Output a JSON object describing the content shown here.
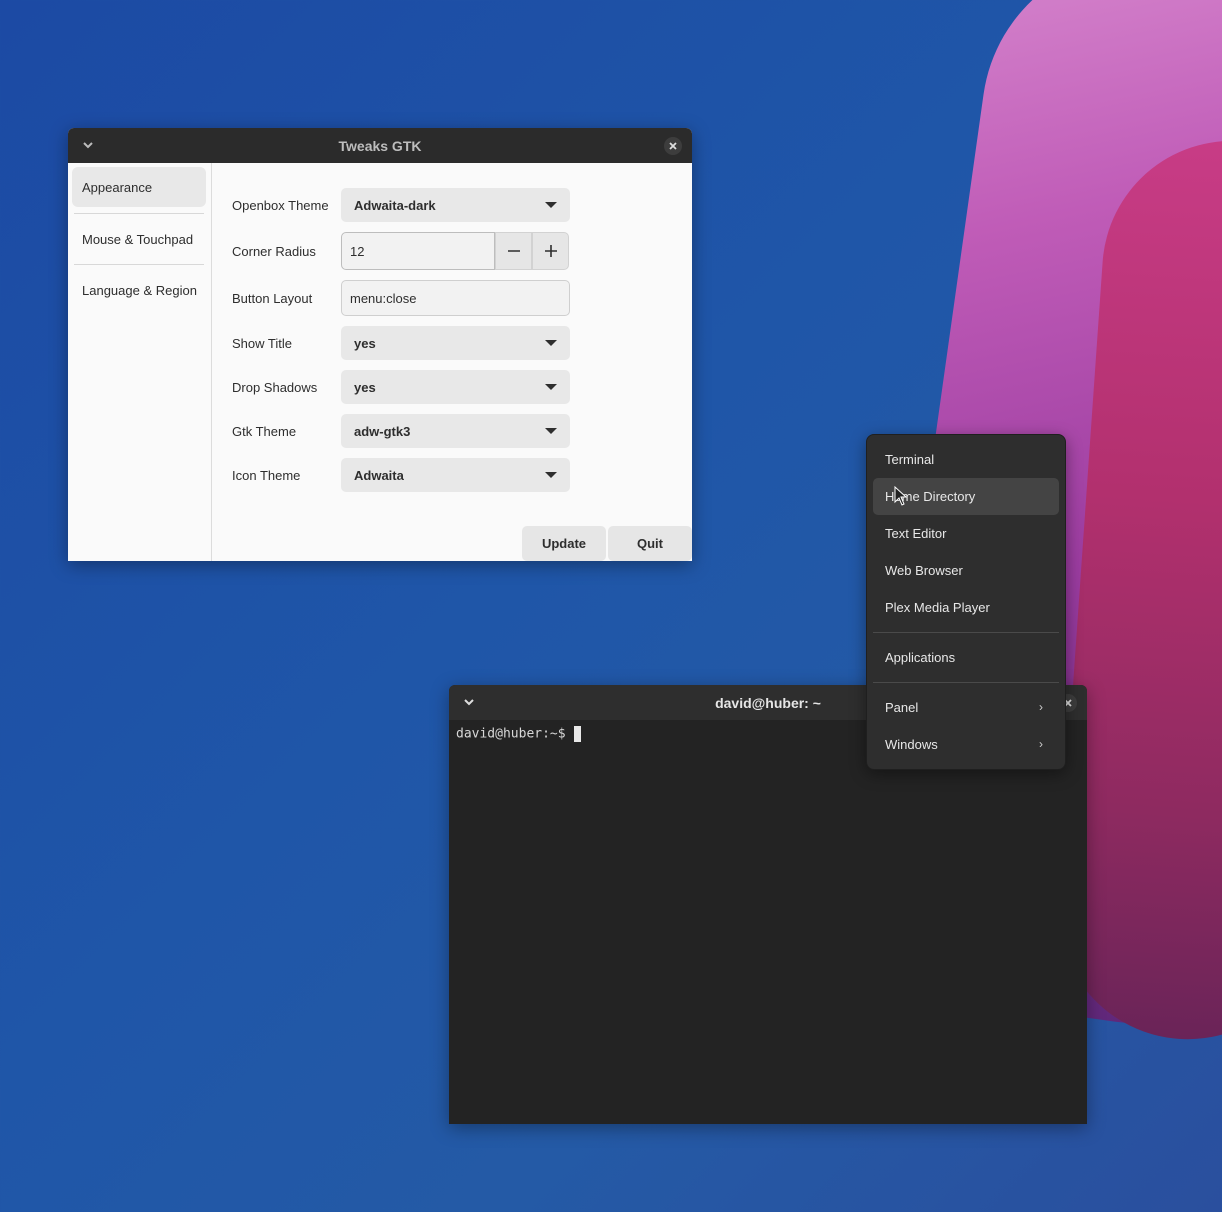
{
  "tweaks_window": {
    "title": "Tweaks GTK",
    "sidebar": [
      {
        "label": "Appearance"
      },
      {
        "label": "Mouse & Touchpad"
      },
      {
        "label": "Language & Region"
      }
    ],
    "settings": {
      "openbox_theme": {
        "label": "Openbox Theme",
        "value": "Adwaita-dark"
      },
      "corner_radius": {
        "label": "Corner Radius",
        "value": "12"
      },
      "button_layout": {
        "label": "Button Layout",
        "value": "menu:close"
      },
      "show_title": {
        "label": "Show Title",
        "value": "yes"
      },
      "drop_shadows": {
        "label": "Drop Shadows",
        "value": "yes"
      },
      "gtk_theme": {
        "label": "Gtk Theme",
        "value": "adw-gtk3"
      },
      "icon_theme": {
        "label": "Icon Theme",
        "value": "Adwaita"
      }
    },
    "buttons": {
      "update": "Update",
      "quit": "Quit"
    }
  },
  "terminal_window": {
    "title": "david@huber: ~",
    "prompt": "david@huber:~$"
  },
  "context_menu": {
    "items": [
      {
        "label": "Terminal"
      },
      {
        "label": "Home Directory"
      },
      {
        "label": "Text Editor"
      },
      {
        "label": "Web Browser"
      },
      {
        "label": "Plex Media Player"
      },
      {
        "label": "Applications"
      },
      {
        "label": "Panel"
      },
      {
        "label": "Windows"
      }
    ],
    "hovered_item": "Home Directory"
  },
  "icons": {
    "window_menu": "chevron-down-icon",
    "window_close": "close-icon",
    "spin_decrease": "minus-icon",
    "spin_increase": "plus-icon",
    "submenu": "chevron-right-icon"
  }
}
